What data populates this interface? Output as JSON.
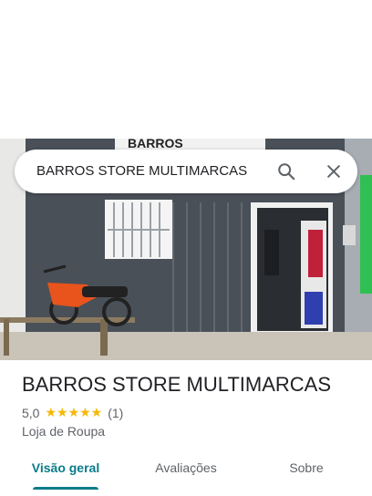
{
  "search": {
    "query": "BARROS STORE MULTIMARCAS"
  },
  "photo": {
    "sign_text": "BARROS"
  },
  "place": {
    "name": "BARROS STORE MULTIMARCAS",
    "rating": "5,0",
    "stars": "★★★★★",
    "review_count": "(1)",
    "category": "Loja de Roupa"
  },
  "tabs": [
    {
      "label": "Visão geral",
      "active": true
    },
    {
      "label": "Avaliações",
      "active": false
    },
    {
      "label": "Sobre",
      "active": false
    }
  ],
  "colors": {
    "accent": "#0a7c8a",
    "star": "#f6b704"
  }
}
